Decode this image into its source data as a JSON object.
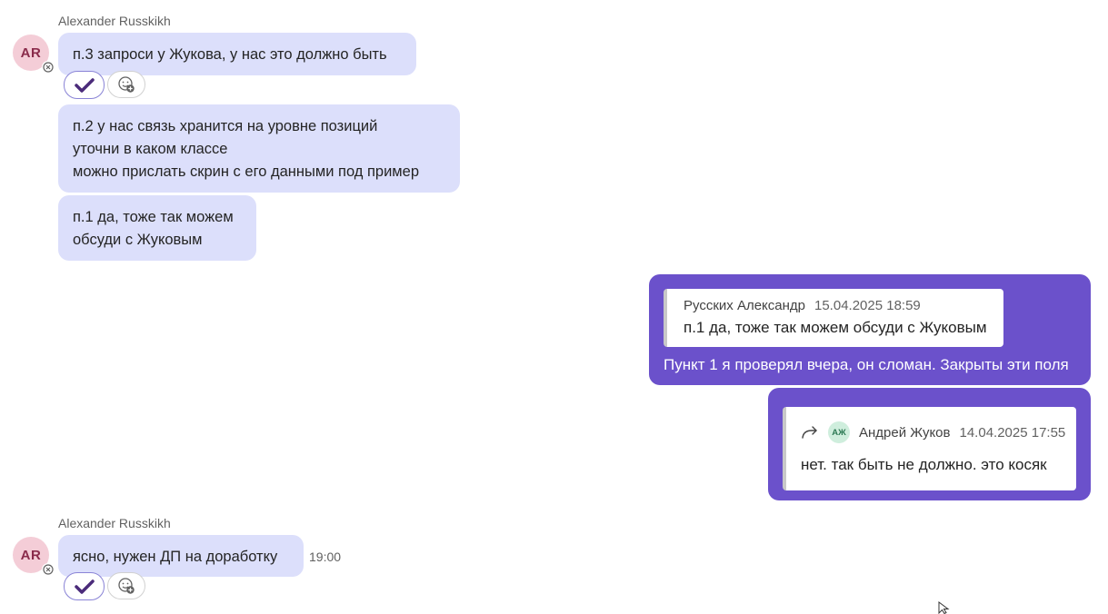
{
  "top_group": {
    "sender_name": "Alexander Russkikh",
    "avatar_initials": "AR",
    "messages": [
      {
        "lines": [
          "п.3 запроси у Жукова, у нас это должно быть"
        ]
      },
      {
        "lines": [
          "п.2 у нас связь хранится на уровне позиций",
          "уточни в каком классе",
          "можно прислать скрин с его данными под пример"
        ]
      },
      {
        "lines": [
          "п.1 да, тоже так можем",
          "обсуди с Жуковым"
        ]
      }
    ]
  },
  "own_messages": {
    "reply": {
      "quote_author": "Русских Александр",
      "quote_date": "15.04.2025 18:59",
      "quote_text": "п.1 да, тоже так можем обсуди с Жуковым",
      "text": "Пункт 1 я проверял вчера, он сломан. Закрыты эти поля"
    },
    "forward": {
      "avatar_initials": "АЖ",
      "author": "Андрей Жуков",
      "date": "14.04.2025 17:55",
      "text": "нет. так быть не должно. это косяк"
    }
  },
  "bottom_group": {
    "sender_name": "Alexander Russkikh",
    "avatar_initials": "AR",
    "message": "ясно, нужен ДП на доработку",
    "time": "19:00"
  },
  "colors": {
    "incoming_bubble": "#dcdffb",
    "outgoing_bubble": "#6b51cb",
    "avatar_bg": "#f4cdd7",
    "reaction_check": "#4b2b7a"
  },
  "icons": [
    "checkmark-reaction-icon",
    "add-reaction-icon",
    "presence-offline-icon",
    "forward-arrow-icon",
    "mouse-cursor-icon"
  ]
}
